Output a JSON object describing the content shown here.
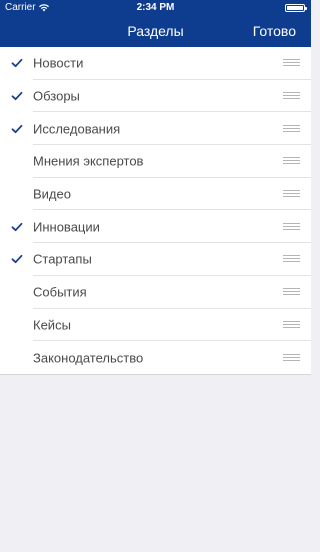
{
  "status_bar": {
    "carrier": "Carrier",
    "time": "2:34 PM",
    "battery_level": 1.0
  },
  "nav": {
    "title": "Разделы",
    "done_label": "Готово"
  },
  "sections": [
    {
      "label": "Новости",
      "checked": true
    },
    {
      "label": "Обзоры",
      "checked": true
    },
    {
      "label": "Исследования",
      "checked": true
    },
    {
      "label": "Мнения экспертов",
      "checked": false
    },
    {
      "label": "Видео",
      "checked": false
    },
    {
      "label": "Инновации",
      "checked": true
    },
    {
      "label": "Стартапы",
      "checked": true
    },
    {
      "label": "События",
      "checked": false
    },
    {
      "label": "Кейсы",
      "checked": false
    },
    {
      "label": "Законодательство",
      "checked": false
    }
  ],
  "colors": {
    "accent": "#0e3d8f",
    "check": "#1a3f8f",
    "background": "#efeff4"
  }
}
